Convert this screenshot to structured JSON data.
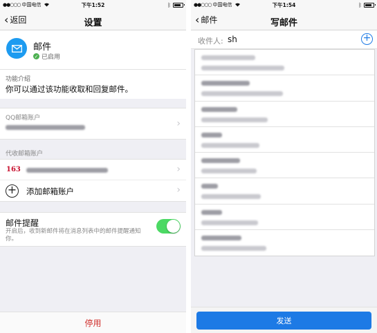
{
  "left": {
    "status": {
      "carrier": "中国电信",
      "time": "下午1:52"
    },
    "nav": {
      "back_label": "返回",
      "title": "设置"
    },
    "app": {
      "name": "邮件",
      "state": "已启用"
    },
    "intro": {
      "label": "功能介绍",
      "text": "你可以通过该功能收取和回复邮件。"
    },
    "qq_account": {
      "label": "QQ邮箱账户"
    },
    "proxy": {
      "label": "代收邮箱账户",
      "logo_text": "163",
      "add_label": "添加邮箱账户"
    },
    "reminder": {
      "title": "邮件提醒",
      "desc": "开启后，收到新邮件将在消息列表中的邮件提醒通知你。",
      "enabled": true
    },
    "disable_button": "停用"
  },
  "right": {
    "status": {
      "carrier": "中国电信",
      "time": "下午1:54"
    },
    "nav": {
      "back_label": "邮件",
      "title": "写邮件"
    },
    "recipient": {
      "label": "收件人:",
      "value": "sh"
    },
    "send_button": "发送"
  },
  "colors": {
    "accent": "#1d7ae5",
    "toggle_on": "#4cd964",
    "danger": "#d0312d",
    "mail_icon_bg": "#1d9bf0"
  }
}
